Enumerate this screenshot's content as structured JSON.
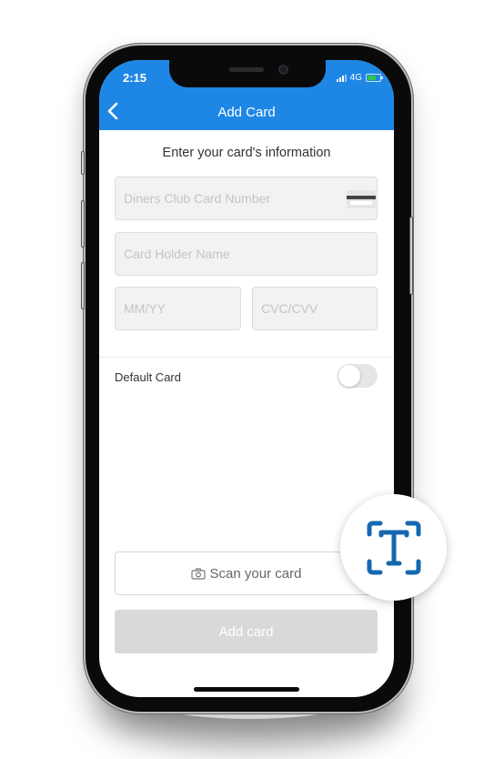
{
  "status_bar": {
    "time": "2:15",
    "network": "4G"
  },
  "header": {
    "title": "Add Card",
    "back_icon": "chevron-left-icon"
  },
  "form": {
    "subtitle": "Enter your card's information",
    "card_number": {
      "placeholder": "Diners Club Card Number",
      "value": "",
      "icon": "credit-card-icon"
    },
    "holder_name": {
      "placeholder": "Card Holder Name",
      "value": ""
    },
    "expiry": {
      "placeholder": "MM/YY",
      "value": ""
    },
    "cvc": {
      "placeholder": "CVC/CVV",
      "value": ""
    },
    "default_card": {
      "label": "Default Card",
      "enabled": false
    }
  },
  "actions": {
    "scan_label": "Scan your card",
    "scan_icon": "camera-icon",
    "add_label": "Add card",
    "add_disabled": true
  },
  "badge": {
    "icon": "text-scan-icon",
    "color": "#1568b0"
  },
  "colors": {
    "accent": "#1e87e5",
    "disabled": "#d9d9d9"
  }
}
